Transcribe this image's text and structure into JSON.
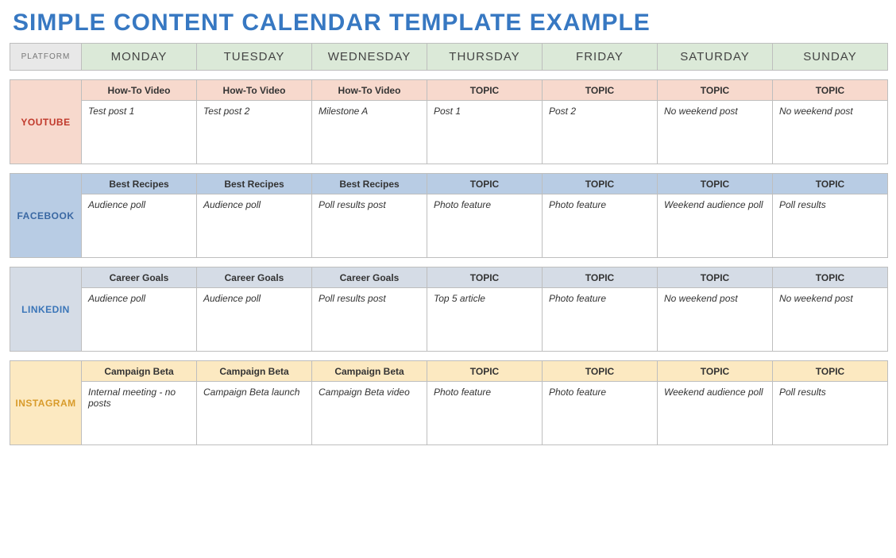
{
  "title": "SIMPLE CONTENT CALENDAR TEMPLATE EXAMPLE",
  "header": {
    "platform_label": "PLATFORM",
    "days": [
      "MONDAY",
      "TUESDAY",
      "WEDNESDAY",
      "THURSDAY",
      "FRIDAY",
      "SATURDAY",
      "SUNDAY"
    ]
  },
  "platforms": [
    {
      "name": "YOUTUBE",
      "class": "youtube",
      "topics": [
        "How-To Video",
        "How-To Video",
        "How-To Video",
        "TOPIC",
        "TOPIC",
        "TOPIC",
        "TOPIC"
      ],
      "content": [
        "Test post 1",
        "Test post 2",
        "Milestone A",
        "Post 1",
        "Post 2",
        "No weekend post",
        "No weekend post"
      ]
    },
    {
      "name": "FACEBOOK",
      "class": "facebook",
      "topics": [
        "Best Recipes",
        "Best Recipes",
        "Best Recipes",
        "TOPIC",
        "TOPIC",
        "TOPIC",
        "TOPIC"
      ],
      "content": [
        "Audience poll",
        "Audience poll",
        "Poll results post",
        "Photo feature",
        "Photo feature",
        "Weekend audience poll",
        "Poll results"
      ]
    },
    {
      "name": "LINKEDIN",
      "class": "linkedin",
      "topics": [
        "Career Goals",
        "Career Goals",
        "Career Goals",
        "TOPIC",
        "TOPIC",
        "TOPIC",
        "TOPIC"
      ],
      "content": [
        "Audience poll",
        "Audience poll",
        "Poll results post",
        "Top 5 article",
        "Photo feature",
        "No weekend post",
        "No weekend post"
      ]
    },
    {
      "name": "INSTAGRAM",
      "class": "instagram",
      "topics": [
        "Campaign Beta",
        "Campaign Beta",
        "Campaign Beta",
        "TOPIC",
        "TOPIC",
        "TOPIC",
        "TOPIC"
      ],
      "content": [
        "Internal meeting - no posts",
        "Campaign Beta launch",
        "Campaign Beta video",
        "Photo feature",
        "Photo feature",
        "Weekend audience poll",
        "Poll results"
      ]
    }
  ]
}
